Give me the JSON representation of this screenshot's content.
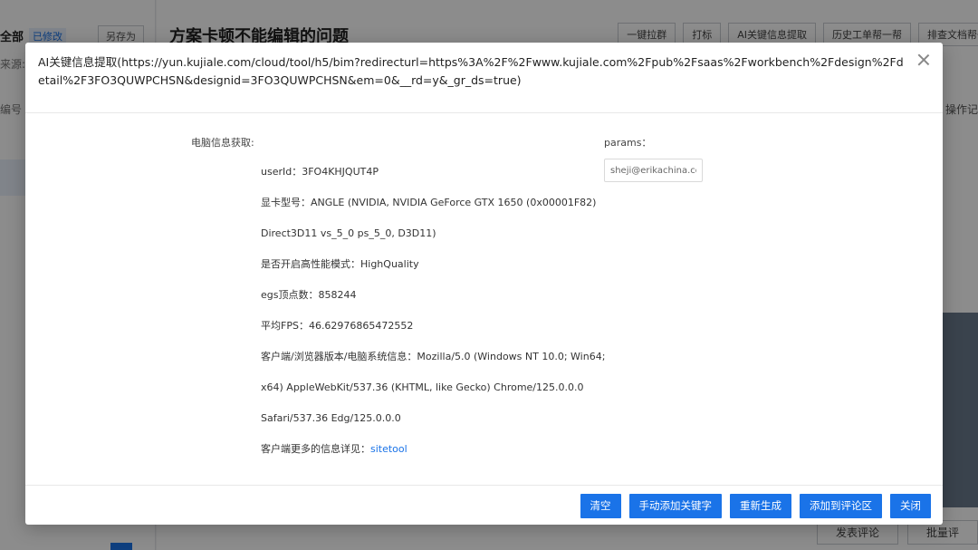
{
  "background": {
    "filter_all": "全部",
    "filter_modified": "已修改",
    "save_as": "另存为",
    "source_label": "来源:",
    "number_label": "编号",
    "page_title": "方案卡顿不能编辑的问题",
    "toolbar_buttons": [
      "一键拉群",
      "打标",
      "AI关键信息提取",
      "历史工单帮一帮",
      "排查文档帮一"
    ],
    "operation_label": "操作记",
    "bottom_buttons": [
      "发表评论",
      "批量评"
    ]
  },
  "modal": {
    "title": "AI关键信息提取(https://yun.kujiale.com/cloud/tool/h5/bim?redirecturl=https%3A%2F%2Fwww.kujiale.com%2Fpub%2Fsaas%2Fworkbench%2Fdesign%2Fdetail%2F3FO3QUWPCHSN&designid=3FO3QUWPCHSN&em=0&__rd=y&_gr_ds=true)",
    "section_label": "电脑信息获取:",
    "info_lines": [
      "userId：3FO4KHJQUT4P",
      "显卡型号：ANGLE (NVIDIA, NVIDIA GeForce GTX 1650 (0x00001F82)",
      "Direct3D11 vs_5_0 ps_5_0, D3D11)",
      "是否开启高性能模式：HighQuality",
      "egs顶点数：858244",
      "平均FPS：46.62976865472552",
      "客户端/浏览器版本/电脑系统信息：Mozilla/5.0 (Windows NT 10.0; Win64;",
      "x64) AppleWebKit/537.36 (KHTML, like Gecko) Chrome/125.0.0.0",
      "Safari/537.36 Edg/125.0.0.0"
    ],
    "more_info_label": "客户端更多的信息详见：",
    "more_info_link": "sitetool",
    "params_label": "params：",
    "params_value": "sheji@erikachina.co",
    "footer_buttons": {
      "clear": "清空",
      "add_keyword": "手动添加关键字",
      "regenerate": "重新生成",
      "add_comment": "添加到评论区",
      "close": "关闭"
    }
  }
}
